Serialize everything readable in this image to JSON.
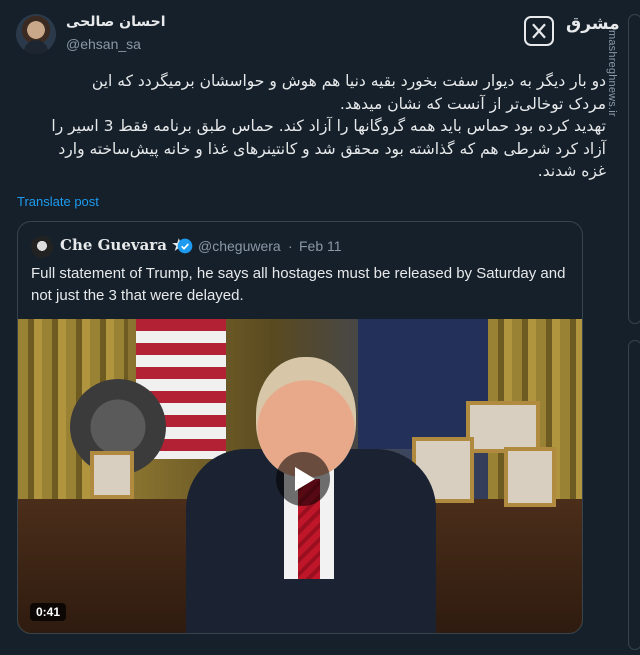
{
  "author": {
    "name": "احسان صالحی",
    "handle": "@ehsan_sa"
  },
  "brand": {
    "logo_text": "مشرق",
    "watermark": "mashreghnews.ir"
  },
  "tweet": {
    "text": "دو بار دیگر به دیوار سفت بخورد بقیه دنیا هم هوش و حواسشان برمیگردد که این\nمردک توخالی‌تر از آنست که نشان میدهد.\nتهدید کرده بود حماس باید همه گروگانها را آزاد کند. حماس طبق برنامه فقط 3 اسیر را\nآزاد کرد شرطی هم که گذاشته بود محقق شد و کانتینرهای غذا و خانه پیش‌ساخته وارد\nغزه شدند.",
    "translate_label": "Translate post"
  },
  "quote": {
    "name": "Che Guevara",
    "name_star": "★",
    "handle": "@cheguwera",
    "separator": "·",
    "date": "Feb 11",
    "text": "Full statement of Trump, he says all hostages must be released by Saturday and not just the 3 that were delayed.",
    "video": {
      "duration": "0:41"
    }
  },
  "icons": {
    "x_logo": "x-logo-icon",
    "verified": "verified-badge-icon",
    "play": "play-icon"
  },
  "colors": {
    "background": "#15202b",
    "link": "#1d9bf0",
    "verified": "#1d9bf0",
    "border": "#38444d"
  }
}
